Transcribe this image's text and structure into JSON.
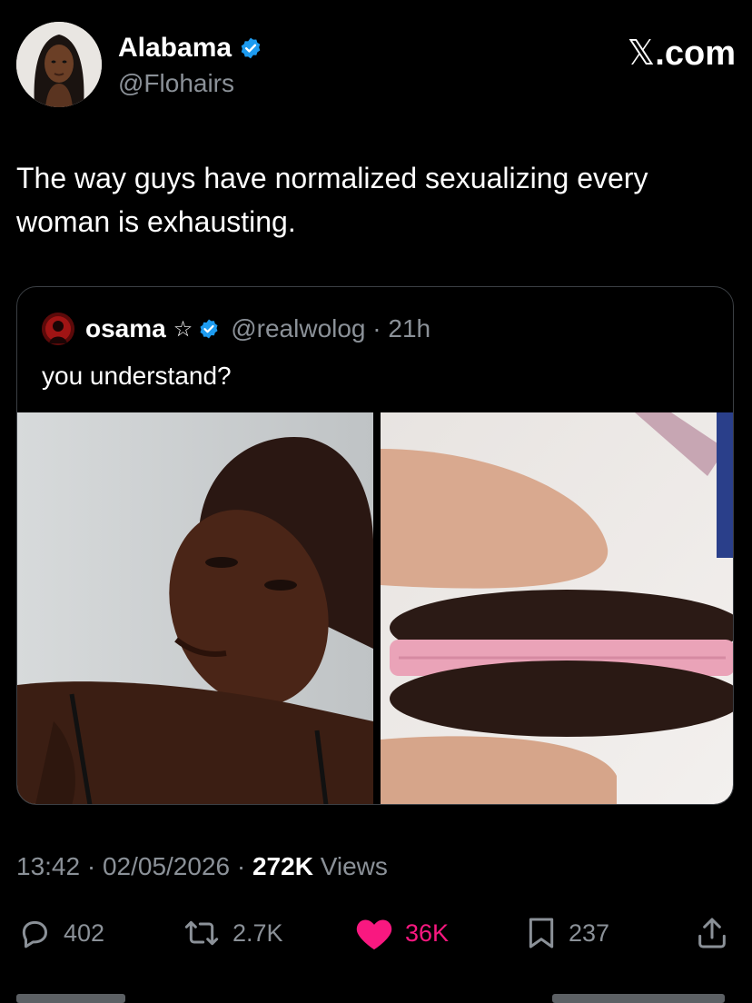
{
  "author": {
    "display_name": "Alabama",
    "handle": "@Flohairs",
    "verified": true
  },
  "brand": {
    "x": "𝕏",
    "label": ".com"
  },
  "tweet": {
    "text": "The way guys have normalized sexualizing every woman is exhausting."
  },
  "quoted": {
    "name": "osama",
    "star": "☆",
    "verified": true,
    "handle": "@realwolog · 21h",
    "text": "you understand?",
    "media": [
      "portrait-photo",
      "pink-cream-cookie-photo"
    ]
  },
  "meta": {
    "time": "13:42 · 02/05/2026 · ",
    "views_count": "272K",
    "views_label": " Views"
  },
  "actions": {
    "replies": "402",
    "reposts": "2.7K",
    "likes": "36K",
    "bookmarks": "237"
  },
  "colors": {
    "background": "#000000",
    "text": "#e7e9ea",
    "muted": "#8b9198",
    "verified_blue": "#1d9bf0",
    "like_pink": "#f91880"
  }
}
